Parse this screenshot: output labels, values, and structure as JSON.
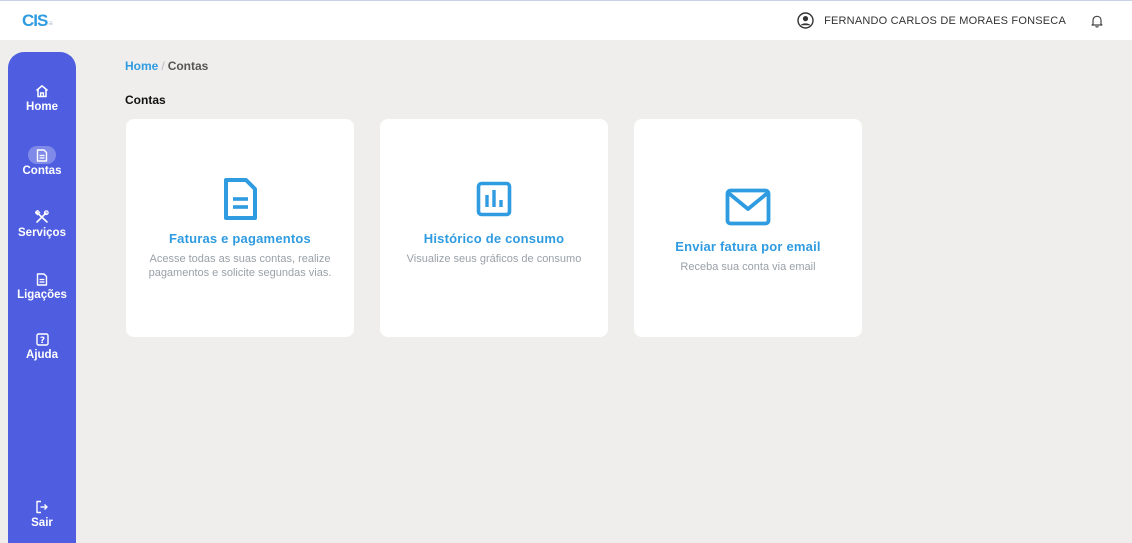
{
  "header": {
    "logo": "CIS",
    "logo_sub": "≡",
    "user_name": "FERNANDO CARLOS DE MORAES FONSECA"
  },
  "sidebar": {
    "items": [
      {
        "label": "Home",
        "icon": "home-icon"
      },
      {
        "label": "Contas",
        "icon": "document-icon",
        "active": true
      },
      {
        "label": "Serviços",
        "icon": "tools-icon"
      },
      {
        "label": "Ligações",
        "icon": "document-icon"
      },
      {
        "label": "Ajuda",
        "icon": "help-icon"
      }
    ],
    "logout": {
      "label": "Sair",
      "icon": "logout-icon"
    }
  },
  "breadcrumb": {
    "home": "Home",
    "separator": "/",
    "current": "Contas"
  },
  "page": {
    "title": "Contas"
  },
  "cards": [
    {
      "title": "Faturas e pagamentos",
      "description": "Acesse todas as suas contas, realize pagamentos e solicite segundas vias.",
      "icon": "invoice-icon"
    },
    {
      "title": "Histórico de consumo",
      "description": "Visualize seus gráficos de consumo",
      "icon": "bar-chart-icon"
    },
    {
      "title": "Enviar fatura por email",
      "description": "Receba sua conta via email",
      "icon": "envelope-icon"
    }
  ],
  "colors": {
    "sidebar": "#4f5ee0",
    "accent": "#2f9be0",
    "background": "#efeeed"
  }
}
